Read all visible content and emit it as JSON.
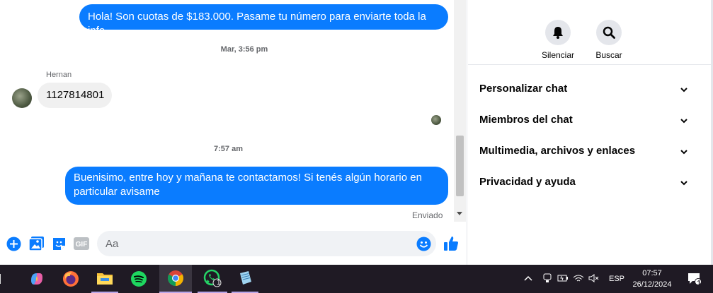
{
  "chat": {
    "msg1": "Hola! Son cuotas de $183.000. Pasame tu número para enviarte toda la info",
    "time1": "Mar, 3:56 pm",
    "sender": "Hernan",
    "msg2": "1127814801",
    "time2": "7:57 am",
    "msg3": "Buenisimo, entre hoy y mañana te contactamos! Si tenés algún horario en particular avisame",
    "status": "Enviado"
  },
  "composer": {
    "placeholder": "Aa"
  },
  "sidebar": {
    "actions": [
      {
        "label": "Silenciar",
        "icon": "bell-icon"
      },
      {
        "label": "Buscar",
        "icon": "search-icon"
      }
    ],
    "sections": [
      {
        "label": "Personalizar chat"
      },
      {
        "label": "Miembros del chat"
      },
      {
        "label": "Multimedia, archivos y enlaces"
      },
      {
        "label": "Privacidad y ayuda"
      }
    ]
  },
  "taskbar": {
    "apps": [
      "copilot-icon",
      "firefox-icon",
      "file-explorer-icon",
      "spotify-icon",
      "chrome-icon",
      "whatsapp-icon",
      "notepad-icon"
    ],
    "whatsapp_badge": "1",
    "language": "ESP",
    "time": "07:57",
    "date": "26/12/2024",
    "notification_badge": "1"
  },
  "colors": {
    "accent": "#0a7cff",
    "taskbar": "#1f1a24"
  }
}
